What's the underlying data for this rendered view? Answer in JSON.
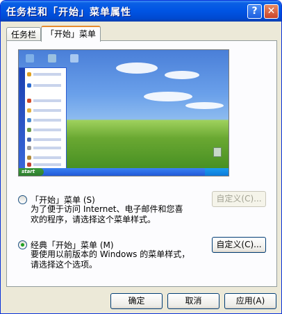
{
  "window": {
    "title": "任务栏和「开始」菜单属性",
    "help_label": "?",
    "close_label": "✕"
  },
  "tabs": [
    {
      "label": "任务栏",
      "active": false
    },
    {
      "label": "「开始」菜单",
      "active": true
    }
  ],
  "preview": {
    "start_label": "start"
  },
  "options": [
    {
      "label": "「开始」菜单 (S)",
      "selected": false,
      "description_lines": [
        "为了便于访问 Internet、电子邮件和您喜",
        "欢的程序，请选择这个菜单样式。"
      ],
      "customize_label": "自定义(C)...",
      "customize_enabled": false
    },
    {
      "label": "经典「开始」菜单 (M)",
      "selected": true,
      "description_lines": [
        "要使用以前版本的 Windows 的菜单样式，",
        "请选择这个选项。"
      ],
      "customize_label": "自定义(C)...",
      "customize_enabled": true
    }
  ],
  "footer": {
    "ok_label": "确定",
    "cancel_label": "取消",
    "apply_label": "应用(A)"
  },
  "colors": {
    "title_bar": "#0054e3",
    "window_bg": "#ece9d8",
    "active_tab_accent": "#e68b2c",
    "radio_dot": "#20a020"
  }
}
